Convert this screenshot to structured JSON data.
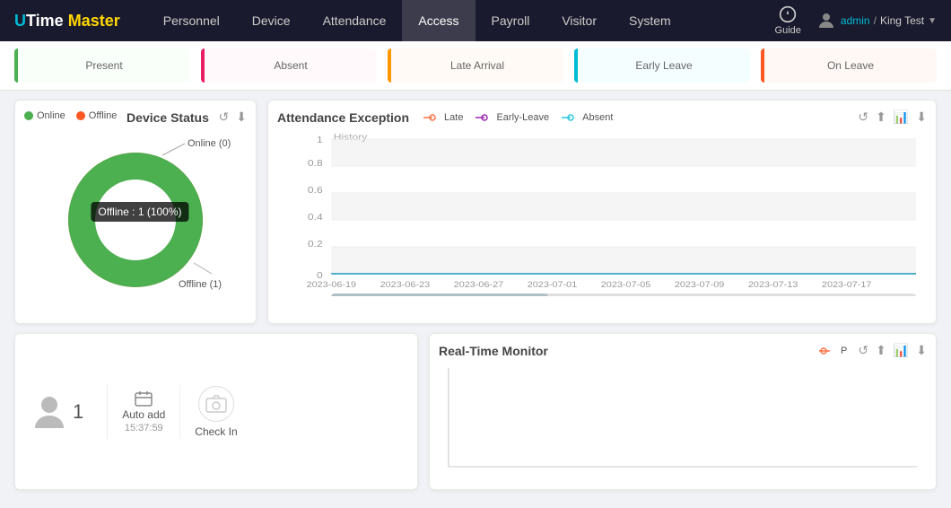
{
  "header": {
    "logo": {
      "u": "U",
      "time": "Time",
      "space": " ",
      "master": "Master"
    },
    "nav": [
      {
        "label": "Personnel",
        "active": false
      },
      {
        "label": "Device",
        "active": false
      },
      {
        "label": "Attendance",
        "active": false
      },
      {
        "label": "Access",
        "active": true
      },
      {
        "label": "Payroll",
        "active": false
      },
      {
        "label": "Visitor",
        "active": false
      },
      {
        "label": "System",
        "active": false
      }
    ],
    "guide_label": "Guide",
    "user": {
      "name": "admin",
      "separator": "/",
      "company": "King Test"
    }
  },
  "status_cards": [
    {
      "label": "Present",
      "type": "present"
    },
    {
      "label": "Absent",
      "type": "absent"
    },
    {
      "label": "Late Arrival",
      "type": "late"
    },
    {
      "label": "Early Leave",
      "type": "early"
    },
    {
      "label": "On Leave",
      "type": "onleave"
    }
  ],
  "device_status": {
    "title": "Device Status",
    "legend": [
      {
        "label": "Online",
        "type": "online"
      },
      {
        "label": "Offline",
        "type": "offline"
      }
    ],
    "tooltip": "Offline : 1 (100%)",
    "online_label": "Online (0)",
    "offline_label": "Offline (1)"
  },
  "attendance_exception": {
    "title": "Attendance Exception",
    "history_label": "History",
    "legend": [
      {
        "label": "Late",
        "type": "late"
      },
      {
        "label": "Early-Leave",
        "type": "early-leave"
      },
      {
        "label": "Absent",
        "type": "absent"
      }
    ],
    "x_labels": [
      "2023-06-19",
      "2023-06-23",
      "2023-06-27",
      "2023-07-01",
      "2023-07-05",
      "2023-07-09",
      "2023-07-13",
      "2023-07-17"
    ],
    "y_labels": [
      "0",
      "0.2",
      "0.4",
      "0.6",
      "0.8",
      "1"
    ]
  },
  "realtime_monitor": {
    "title": "Real-Time Monitor",
    "legend_label": "P"
  },
  "bottom_panel": {
    "user_count": "1",
    "auto_add_label": "Auto add",
    "auto_add_time": "15:37:59",
    "checkin_label": "Check In"
  },
  "icons": {
    "refresh": "↺",
    "upload": "⬆",
    "chart": "📊",
    "download": "⬇",
    "user": "👤",
    "camera": "📷",
    "monitor": "🖥",
    "chevron_down": "▼"
  }
}
